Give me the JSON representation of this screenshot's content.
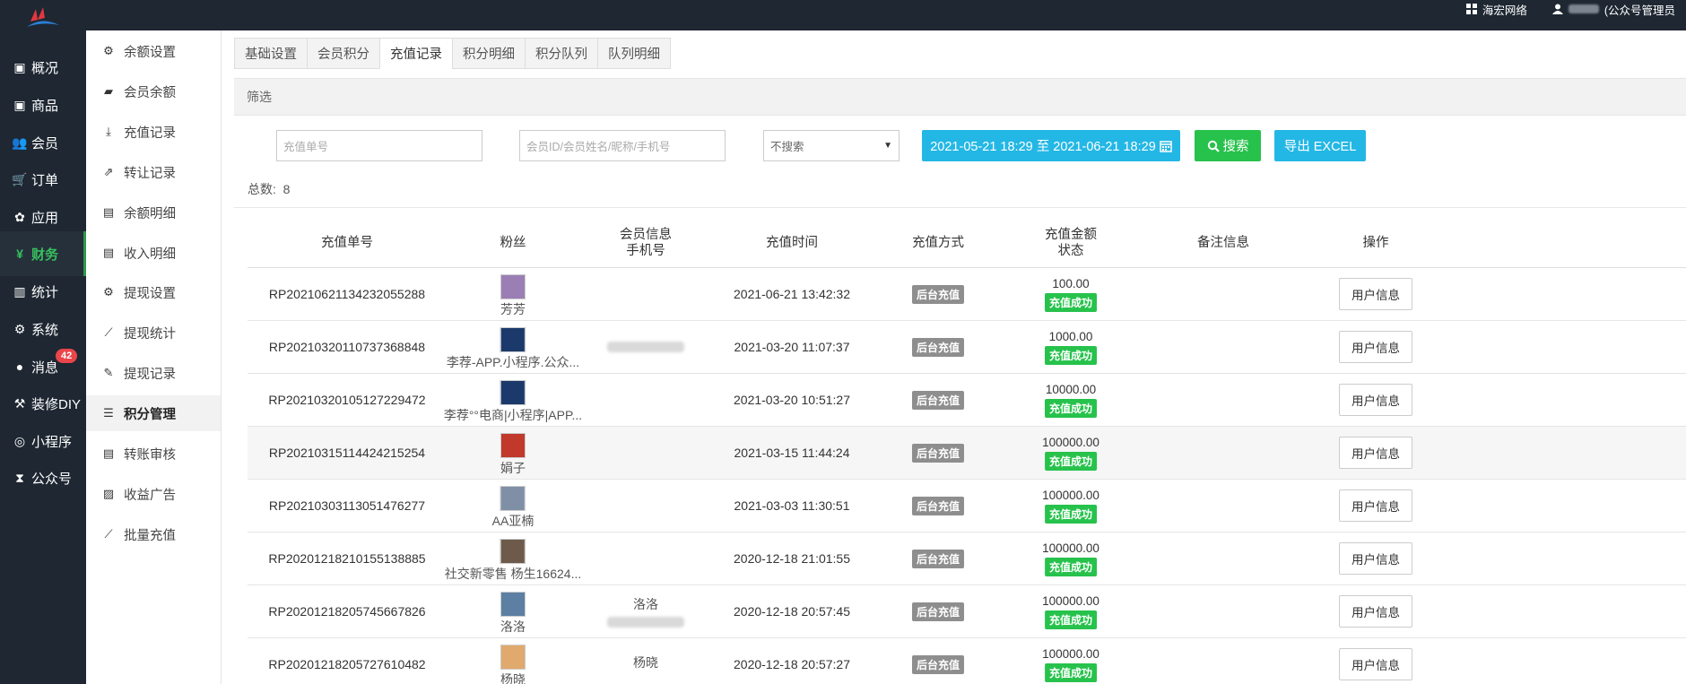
{
  "topbar": {
    "company": "海宏网络",
    "user_suffix": "(公众号管理员"
  },
  "sidebar": {
    "items": [
      {
        "label": "概况",
        "icon": "dashboard-icon"
      },
      {
        "label": "商品",
        "icon": "box-icon"
      },
      {
        "label": "会员",
        "icon": "users-icon"
      },
      {
        "label": "订单",
        "icon": "cart-icon"
      },
      {
        "label": "应用",
        "icon": "apps-icon"
      },
      {
        "label": "财务",
        "icon": "yen-icon"
      },
      {
        "label": "统计",
        "icon": "bar-chart-icon"
      },
      {
        "label": "系统",
        "icon": "cogs-icon"
      },
      {
        "label": "消息",
        "icon": "comment-icon"
      },
      {
        "label": "装修DIY",
        "icon": "gavel-icon"
      },
      {
        "label": "小程序",
        "icon": "wechat-icon"
      },
      {
        "label": "公众号",
        "icon": "hourglass-icon"
      }
    ],
    "message_badge": "42"
  },
  "subnav": {
    "items": [
      {
        "label": "余额设置",
        "icon": "gear-icon"
      },
      {
        "label": "会员余额",
        "icon": "book-icon"
      },
      {
        "label": "充值记录",
        "icon": "download-icon"
      },
      {
        "label": "转让记录",
        "icon": "external-link-icon"
      },
      {
        "label": "余额明细",
        "icon": "file-icon"
      },
      {
        "label": "收入明细",
        "icon": "file-icon"
      },
      {
        "label": "提现设置",
        "icon": "gear-icon"
      },
      {
        "label": "提现统计",
        "icon": "line-chart-icon"
      },
      {
        "label": "提现记录",
        "icon": "pencil-icon"
      },
      {
        "label": "积分管理",
        "icon": "database-icon"
      },
      {
        "label": "转账审核",
        "icon": "file-icon"
      },
      {
        "label": "收益广告",
        "icon": "image-icon"
      },
      {
        "label": "批量充值",
        "icon": "line-chart-icon"
      }
    ]
  },
  "tabs": [
    "基础设置",
    "会员积分",
    "充值记录",
    "积分明细",
    "积分队列",
    "队列明细"
  ],
  "filter": {
    "title": "筛选",
    "order_placeholder": "充值单号",
    "member_placeholder": "会员ID/会员姓名/昵称/手机号",
    "select_value": "不搜索",
    "date_range": "2021-05-21 18:29 至 2021-06-21 18:29",
    "search_label": "搜索",
    "export_label": "导出 EXCEL"
  },
  "total": {
    "label": "总数:",
    "value": "8"
  },
  "table": {
    "headers": {
      "order_no": "充值单号",
      "fan": "粉丝",
      "member_info": "会员信息",
      "phone": "手机号",
      "time": "充值时间",
      "method": "充值方式",
      "amount": "充值金额",
      "status": "状态",
      "remark": "备注信息",
      "action": "操作"
    },
    "rows": [
      {
        "order_no": "RP20210621134232055288",
        "fan": "芳芳",
        "member_name": "",
        "phone_blurred": false,
        "time": "2021-06-21 13:42:32",
        "method": "后台充值",
        "amount": "100.00",
        "status": "充值成功",
        "action": "用户信息",
        "avatar_color": "#9b7fb4"
      },
      {
        "order_no": "RP20210320110737368848",
        "fan": "李荐-APP.小程序.公众...",
        "member_name": "",
        "phone_blurred": true,
        "time": "2021-03-20 11:07:37",
        "method": "后台充值",
        "amount": "1000.00",
        "status": "充值成功",
        "action": "用户信息",
        "avatar_color": "#1b3a6b"
      },
      {
        "order_no": "RP20210320105127229472",
        "fan": "李荐°°电商|小程序|APP...",
        "member_name": "",
        "phone_blurred": false,
        "time": "2021-03-20 10:51:27",
        "method": "后台充值",
        "amount": "10000.00",
        "status": "充值成功",
        "action": "用户信息",
        "avatar_color": "#1b3a6b"
      },
      {
        "order_no": "RP20210315114424215254",
        "fan": "娟子",
        "member_name": "",
        "phone_blurred": false,
        "time": "2021-03-15 11:44:24",
        "method": "后台充值",
        "amount": "100000.00",
        "status": "充值成功",
        "action": "用户信息",
        "avatar_color": "#c0392b"
      },
      {
        "order_no": "RP20210303113051476277",
        "fan": "AA亚楠",
        "member_name": "",
        "phone_blurred": false,
        "time": "2021-03-03 11:30:51",
        "method": "后台充值",
        "amount": "100000.00",
        "status": "充值成功",
        "action": "用户信息",
        "avatar_color": "#7f8fa6"
      },
      {
        "order_no": "RP20201218210155138885",
        "fan": "社交新零售 杨生16624...",
        "member_name": "",
        "phone_blurred": false,
        "time": "2020-12-18 21:01:55",
        "method": "后台充值",
        "amount": "100000.00",
        "status": "充值成功",
        "action": "用户信息",
        "avatar_color": "#6d5a4a"
      },
      {
        "order_no": "RP20201218205745667826",
        "fan": "洛洛",
        "member_name": "洛洛",
        "phone_blurred": true,
        "time": "2020-12-18 20:57:45",
        "method": "后台充值",
        "amount": "100000.00",
        "status": "充值成功",
        "action": "用户信息",
        "avatar_color": "#5d7fa3"
      },
      {
        "order_no": "RP20201218205727610482",
        "fan": "杨晓",
        "member_name": "杨晓",
        "phone_blurred": false,
        "time": "2020-12-18 20:57:27",
        "method": "后台充值",
        "amount": "100000.00",
        "status": "充值成功",
        "action": "用户信息",
        "avatar_color": "#e0a96d"
      }
    ]
  },
  "colors": {
    "sidebar_bg": "#1e2732",
    "active_green": "#37bf5e",
    "info_blue": "#23b7e5",
    "success_green": "#27c24c",
    "tag_gray": "#8e8e8e",
    "badge_red": "#e9454b"
  }
}
